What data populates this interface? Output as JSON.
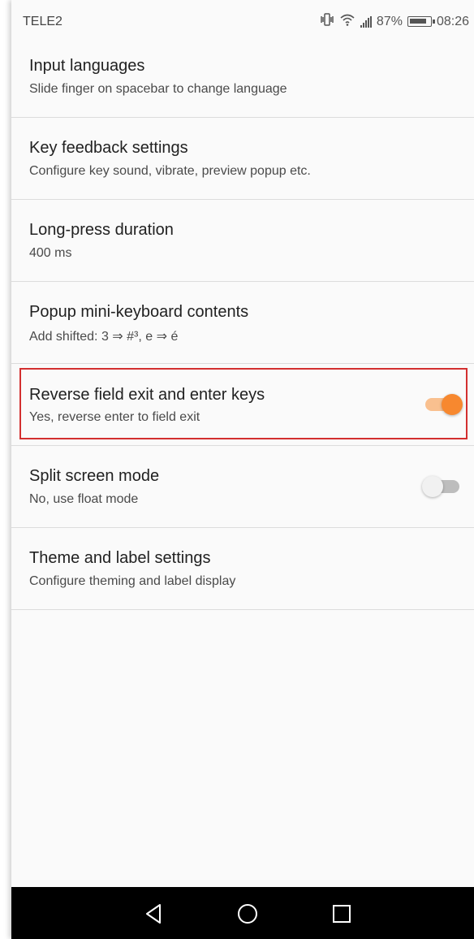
{
  "status_bar": {
    "carrier": "TELE2",
    "battery_percent": "87%",
    "time": "08:26"
  },
  "settings": [
    {
      "title": "Input languages",
      "summary": "Slide finger on spacebar to change language"
    },
    {
      "title": "Key feedback settings",
      "summary": "Configure key sound, vibrate, preview popup etc."
    },
    {
      "title": "Long-press duration",
      "summary": "400 ms"
    },
    {
      "title": "Popup mini-keyboard contents",
      "summary": "Add shifted: 3 ⇒ #³, e ⇒ é"
    },
    {
      "title": "Reverse field exit and enter keys",
      "summary": "Yes, reverse enter to field exit",
      "toggle": true
    },
    {
      "title": "Split screen mode",
      "summary": "No, use float mode",
      "toggle": false
    },
    {
      "title": "Theme and label settings",
      "summary": "Configure theming and label display"
    }
  ],
  "colors": {
    "accent": "#f7882f",
    "highlight_border": "#d32f2f"
  },
  "nav_bar": {
    "back_icon": "back-triangle-icon",
    "home_icon": "home-circle-icon",
    "recents_icon": "recents-square-icon"
  }
}
